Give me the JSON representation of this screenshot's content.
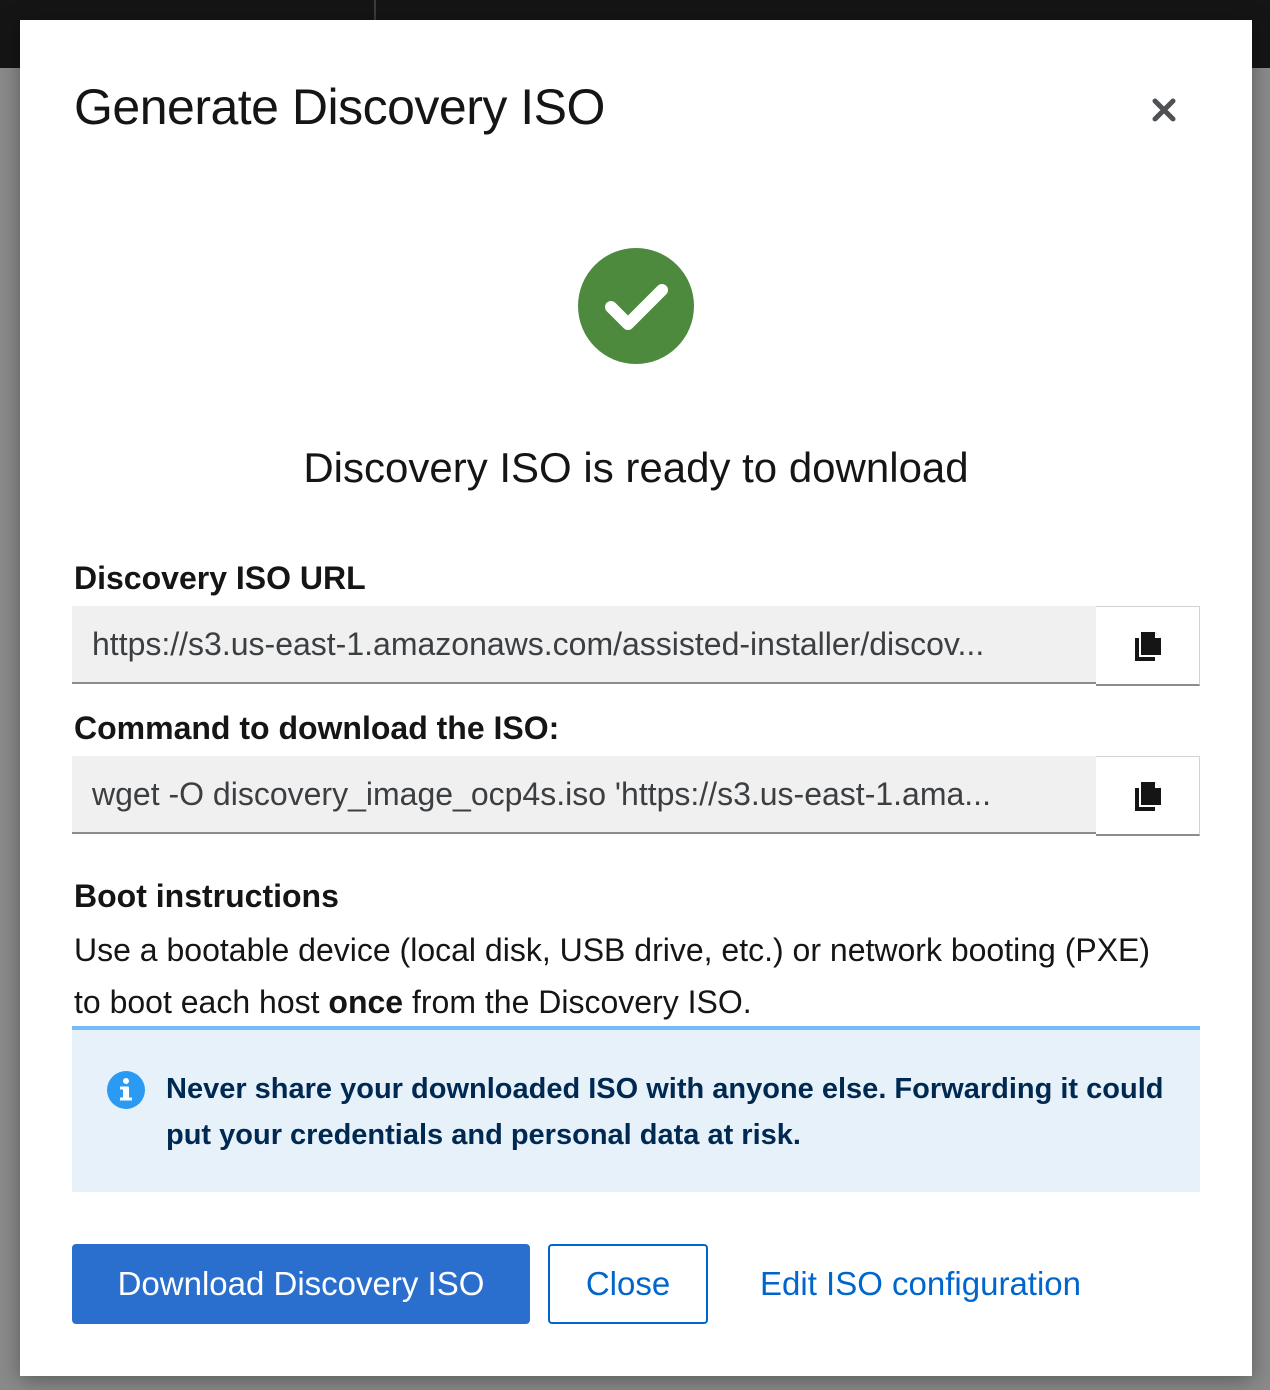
{
  "modal": {
    "title": "Generate Discovery ISO",
    "status_text": "Discovery ISO is ready to download",
    "url_label": "Discovery ISO URL",
    "url_value": "https://s3.us-east-1.amazonaws.com/assisted-installer/discov...",
    "command_label": "Command to download the ISO:",
    "command_value": "wget -O discovery_image_ocp4s.iso 'https://s3.us-east-1.ama...",
    "boot_title": "Boot instructions",
    "boot_text_before": "Use a bootable device (local disk, USB drive, etc.) or network booting (PXE) to boot each host ",
    "boot_text_bold": "once",
    "boot_text_after": " from the Discovery ISO.",
    "alert_text": "Never share your downloaded ISO with anyone else. Forwarding it could put your credentials and personal data at risk.",
    "buttons": {
      "download": "Download Discovery ISO",
      "close": "Close",
      "edit": "Edit ISO configuration"
    }
  },
  "colors": {
    "primary": "#2b6fce",
    "link": "#0066cc",
    "success": "#4d8a3e",
    "alert_bg": "#e7f1fa",
    "alert_border": "#73bcf7",
    "info_icon": "#2b9af3"
  },
  "icons": [
    "close-icon",
    "check-circle-icon",
    "copy-icon",
    "info-circle-icon"
  ]
}
